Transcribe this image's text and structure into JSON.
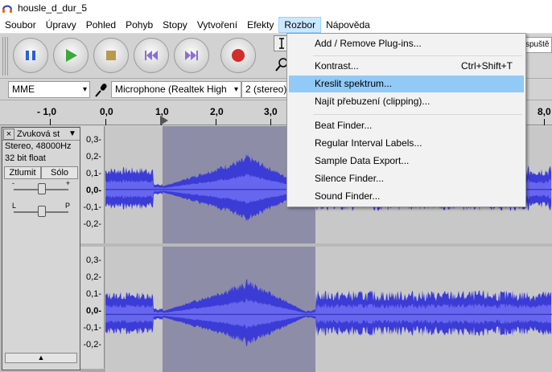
{
  "window": {
    "title": "housle_d_dur_5"
  },
  "menubar": [
    "Soubor",
    "Úpravy",
    "Pohled",
    "Pohyb",
    "Stopy",
    "Vytvoření",
    "Efekty",
    "Rozbor",
    "Nápověda"
  ],
  "menubar_active": "Rozbor",
  "toolbar": {
    "pause": "pause-icon",
    "play": "play-icon",
    "stop": "stop-icon",
    "skip_start": "skip-to-start-icon",
    "skip_end": "skip-to-end-icon",
    "record": "record-icon",
    "meter_text": "spuště"
  },
  "devices": {
    "host": "MME",
    "recording_device": "Microphone (Realtek High",
    "channels": "2 (stereo)"
  },
  "ruler": {
    "labels": [
      "- 1,0",
      "0,0",
      "1,0",
      "2,0",
      "3,0",
      "8,0"
    ]
  },
  "track": {
    "name": "Zvuková st",
    "info_line1": "Stereo, 48000Hz",
    "info_line2": "32 bit float",
    "mute": "Ztlumit",
    "solo": "Sólo",
    "gain_minus": "-",
    "gain_plus": "+",
    "pan_left": "L",
    "pan_right": "P"
  },
  "scale": [
    "0,3-",
    "0,2-",
    "0,1-",
    "0,0-",
    "-0,1-",
    "-0,2-"
  ],
  "dropdown_menu": {
    "items": [
      {
        "label": "Add / Remove Plug-ins...",
        "shortcut": ""
      },
      {
        "label": "Kontrast...",
        "shortcut": "Ctrl+Shift+T"
      },
      {
        "label": "Kreslit spektrum...",
        "shortcut": "",
        "highlighted": true
      },
      {
        "label": "Najít přebuzení (clipping)...",
        "shortcut": ""
      },
      {
        "label": "Beat Finder...",
        "shortcut": ""
      },
      {
        "label": "Regular Interval Labels...",
        "shortcut": ""
      },
      {
        "label": "Sample Data Export...",
        "shortcut": ""
      },
      {
        "label": "Silence Finder...",
        "shortcut": ""
      },
      {
        "label": "Sound Finder...",
        "shortcut": ""
      }
    ]
  },
  "colors": {
    "waveform": "#3b3bd6",
    "waveform_rms": "#6666ee",
    "selection": "#8d8da8",
    "highlight": "#91c9f7"
  }
}
